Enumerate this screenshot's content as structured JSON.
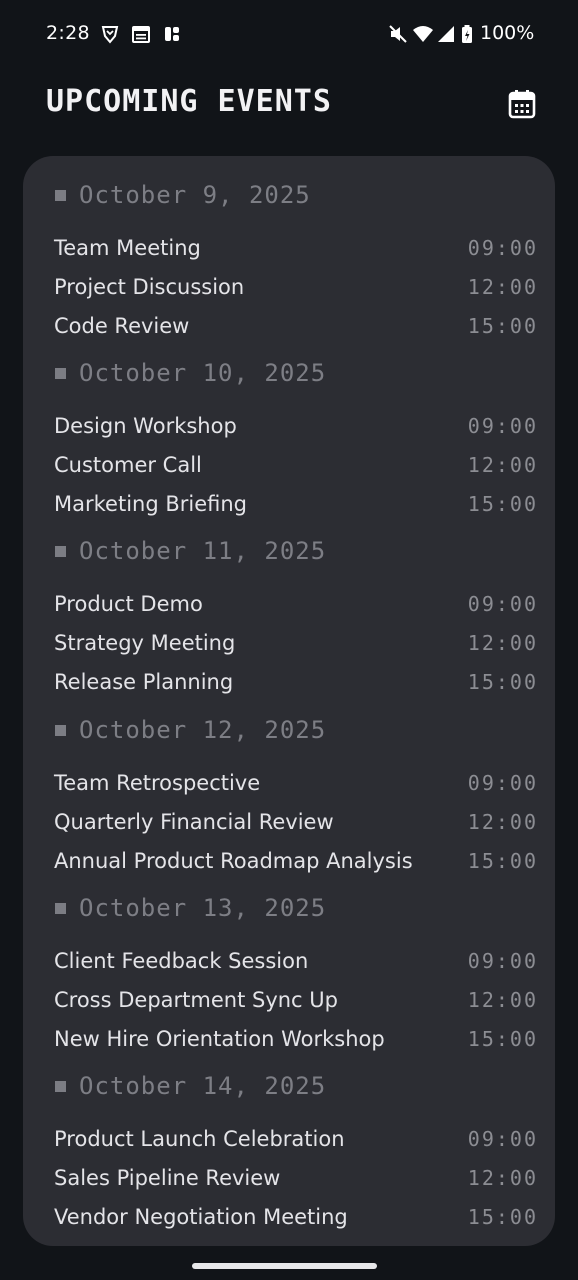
{
  "status_bar": {
    "time": "2:28",
    "battery_percent": "100%",
    "icons": [
      "brave-icon",
      "calendar-notification-icon",
      "app-notification-icon",
      "mute-icon",
      "wifi-icon",
      "signal-icon",
      "battery-charging-icon"
    ]
  },
  "header": {
    "title": "UPCOMING EVENTS",
    "calendar_icon": "calendar-icon"
  },
  "days": [
    {
      "date": "October 9, 2025",
      "events": [
        {
          "title": "Team Meeting",
          "time": "09:00"
        },
        {
          "title": "Project Discussion",
          "time": "12:00"
        },
        {
          "title": "Code Review",
          "time": "15:00"
        }
      ]
    },
    {
      "date": "October 10, 2025",
      "events": [
        {
          "title": "Design Workshop",
          "time": "09:00"
        },
        {
          "title": "Customer Call",
          "time": "12:00"
        },
        {
          "title": "Marketing Briefing",
          "time": "15:00"
        }
      ]
    },
    {
      "date": "October 11, 2025",
      "events": [
        {
          "title": "Product Demo",
          "time": "09:00"
        },
        {
          "title": "Strategy Meeting",
          "time": "12:00"
        },
        {
          "title": "Release Planning",
          "time": "15:00"
        }
      ]
    },
    {
      "date": "October 12, 2025",
      "events": [
        {
          "title": "Team Retrospective",
          "time": "09:00"
        },
        {
          "title": "Quarterly Financial Review",
          "time": "12:00"
        },
        {
          "title": "Annual Product Roadmap Analysis",
          "time": "15:00"
        }
      ]
    },
    {
      "date": "October 13, 2025",
      "events": [
        {
          "title": "Client Feedback Session",
          "time": "09:00"
        },
        {
          "title": "Cross Department Sync Up",
          "time": "12:00"
        },
        {
          "title": "New Hire Orientation Workshop",
          "time": "15:00"
        }
      ]
    },
    {
      "date": "October 14, 2025",
      "events": [
        {
          "title": "Product Launch Celebration",
          "time": "09:00"
        },
        {
          "title": "Sales Pipeline Review",
          "time": "12:00"
        },
        {
          "title": "Vendor Negotiation Meeting",
          "time": "15:00"
        }
      ]
    }
  ]
}
